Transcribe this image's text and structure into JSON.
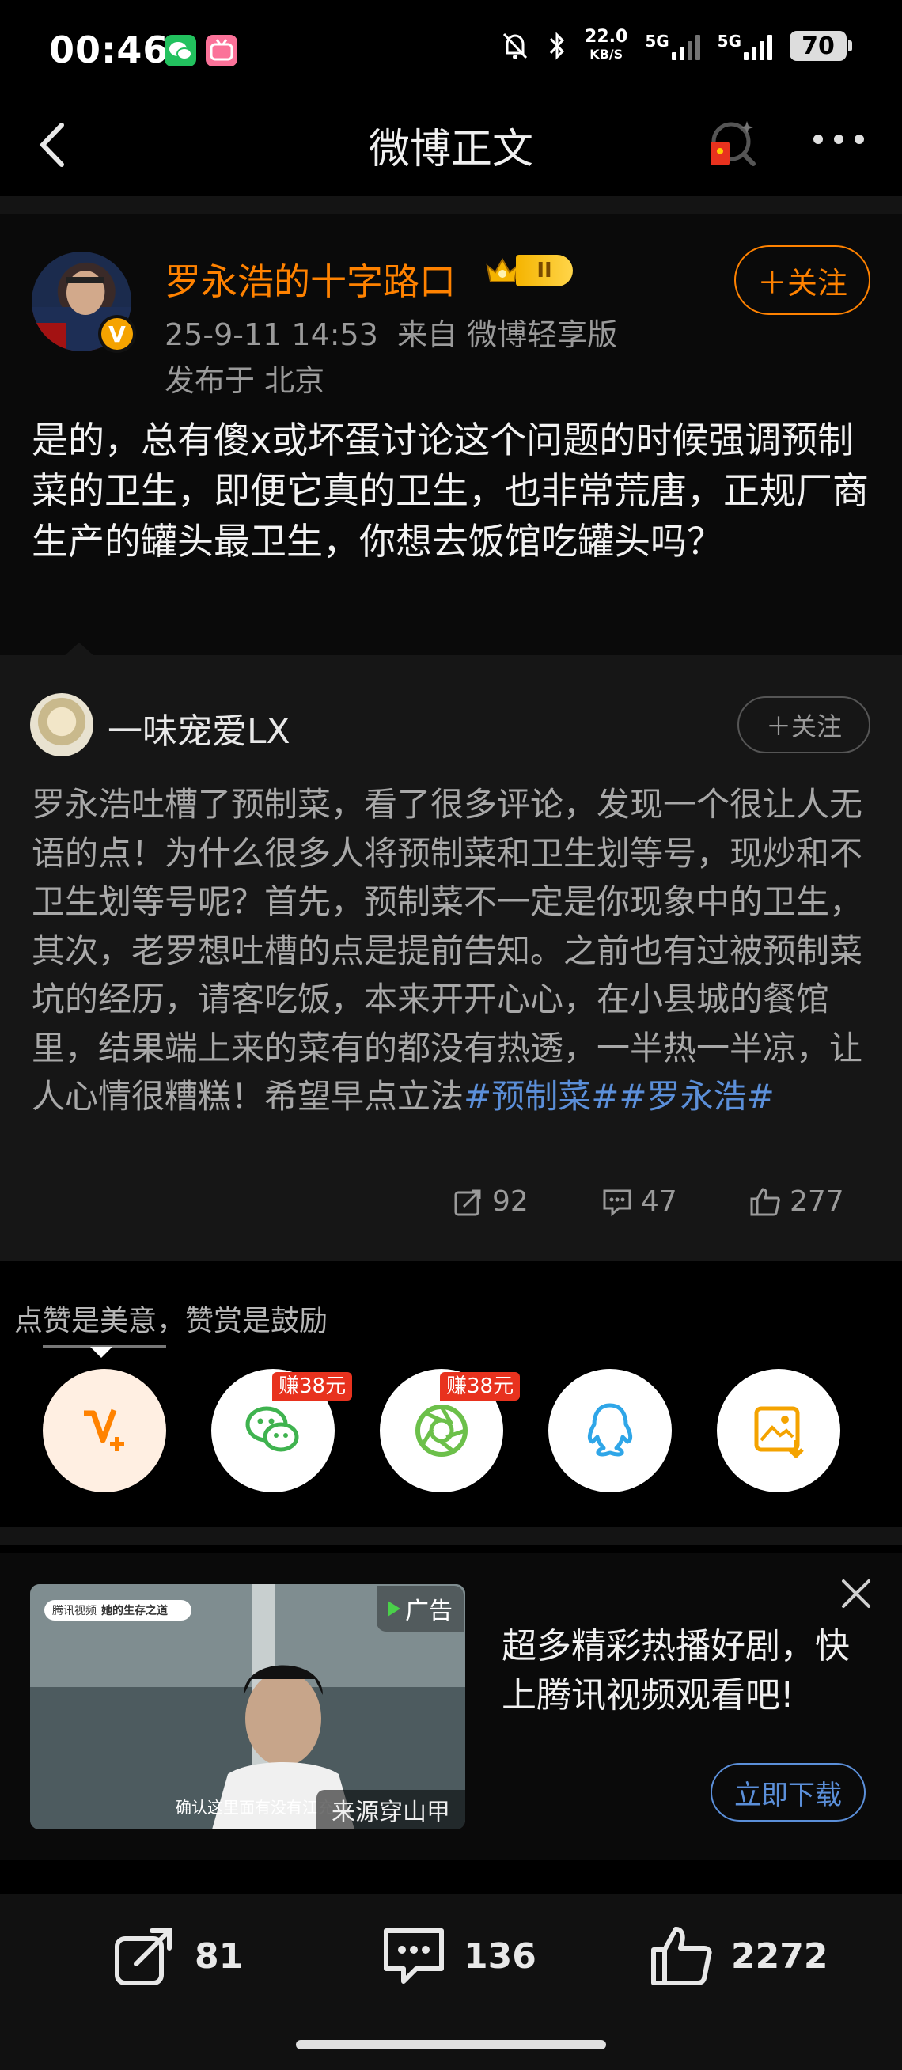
{
  "status_bar": {
    "time": "00:46",
    "net_speed_value": "22.0",
    "net_speed_unit": "KB/S",
    "sim1_type": "5G",
    "sim2_type": "5G",
    "battery": "70"
  },
  "nav": {
    "title": "微博正文"
  },
  "post": {
    "author": "罗永浩的十字路口",
    "level_badge": "II",
    "verified_mark": "V",
    "timestamp": "25-9-11 14:53",
    "source": "来自 微博轻享版",
    "location": "发布于 北京",
    "follow_label": "＋关注",
    "text": "是的，总有傻x或坏蛋讨论这个问题的时候强调预制菜的卫生，即便它真的卫生，也非常荒唐，正规厂商生产的罐头最卫生，你想去饭馆吃罐头吗？"
  },
  "retweet": {
    "author": "一味宠爱LX",
    "follow_label": "＋关注",
    "text": "罗永浩吐槽了预制菜，看了很多评论，发现一个很让人无语的点！为什么很多人将预制菜和卫生划等号，现炒和不卫生划等号呢？首先，预制菜不一定是你现象中的卫生，其次，老罗想吐槽的点是提前告知。之前也有过被预制菜坑的经历，请客吃饭，本来开开心心，在小县城的餐馆里，结果端上来的菜有的都没有热透，一半热一半凉，让人心情很糟糕！希望早点立法",
    "hashtags": "#预制菜##罗永浩#",
    "reposts": "92",
    "comments": "47",
    "likes": "277"
  },
  "reward": {
    "caption": "点赞是美意，赞赏是鼓励",
    "earn_badge_1": "赚38元",
    "earn_badge_2": "赚38元",
    "buttons": [
      "reward-v-icon",
      "wechat-icon",
      "moments-icon",
      "qq-icon",
      "save-image-icon"
    ]
  },
  "ad": {
    "label": "广告",
    "source_tag": "来源穿山甲",
    "headline": "超多精彩热播好剧，快上腾讯视频观看吧!",
    "download_label": "立即下载",
    "thumb_search_brand": "腾讯视频",
    "thumb_search_text": "她的生存之道",
    "thumb_subtitle": "确认这里面有没有江充"
  },
  "bottom_bar": {
    "reposts": "81",
    "comments": "136",
    "likes": "2272"
  },
  "colors": {
    "accent_orange": "#ff8200",
    "link_blue": "#5b8fd9",
    "badge_red": "#e8321e"
  }
}
